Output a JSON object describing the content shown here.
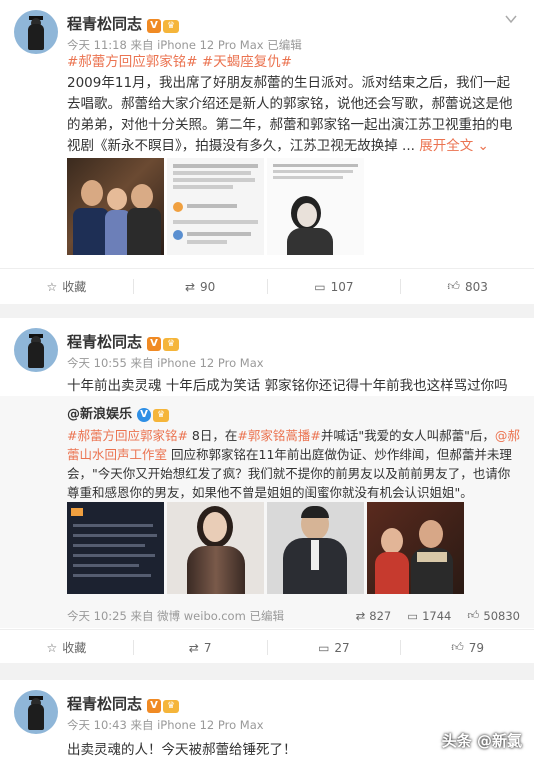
{
  "post1": {
    "username": "程青松同志",
    "meta": "今天 11:18 来自 iPhone 12 Pro Max   已编辑",
    "tag1": "#郝蕾方回应郭家铭#",
    "tag2": "#天蝎座复仇#",
    "text": "2009年11月，我出席了好朋友郝蕾的生日派对。派对结束之后，我们一起去唱歌。郝蕾给大家介绍还是新人的郭家铭，说他还会写歌，郝蕾说这是他的弟弟，对他十分关照。第二年，郝蕾和郭家铭一起出演江苏卫视重拍的电视剧《新永不瞑目》，拍摄没有多久，江苏卫视无故换掉 ...",
    "more_label": "展开全文",
    "actions": {
      "fav": "收藏",
      "repost": "90",
      "comment": "107",
      "like": "803"
    }
  },
  "post2": {
    "username": "程青松同志",
    "meta": "今天 10:55 来自 iPhone 12 Pro Max",
    "text": "十年前出卖灵魂 十年后成为笑话 郭家铭你还记得十年前我也这样骂过你吗",
    "repost": {
      "author": "@新浪娱乐",
      "tag1": "#郝蕾方回应郭家铭#",
      "text_a": " 8日，在",
      "tag2": "#郭家铭蒿播#",
      "text_b": "并喊话\"我爱的女人叫郝蕾\"后，",
      "link": "@郝蕾山水回声工作室",
      "text_c": " 回应称郭家铭在11年前出庭做伪证、炒作绯闻，但郝蕾并未理会，\"今天你又开始想红发了疯？我们就不提你的前男友以及前前男友了，也请你尊重和感恩你的男友，如果他不曾是姐姐的闺蜜你就没有机会认识姐姐\"。",
      "meta": "今天 10:25 来自 微博 weibo.com   已编辑",
      "repost_count": "827",
      "comment_count": "1744",
      "like_count": "50830"
    },
    "actions": {
      "fav": "收藏",
      "repost": "7",
      "comment": "27",
      "like": "79"
    }
  },
  "post3": {
    "username": "程青松同志",
    "meta": "今天 10:43 来自 iPhone 12 Pro Max",
    "text": "出卖灵魂的人！今天被郝蕾给锤死了！"
  },
  "watermark": "头条 @新氯"
}
